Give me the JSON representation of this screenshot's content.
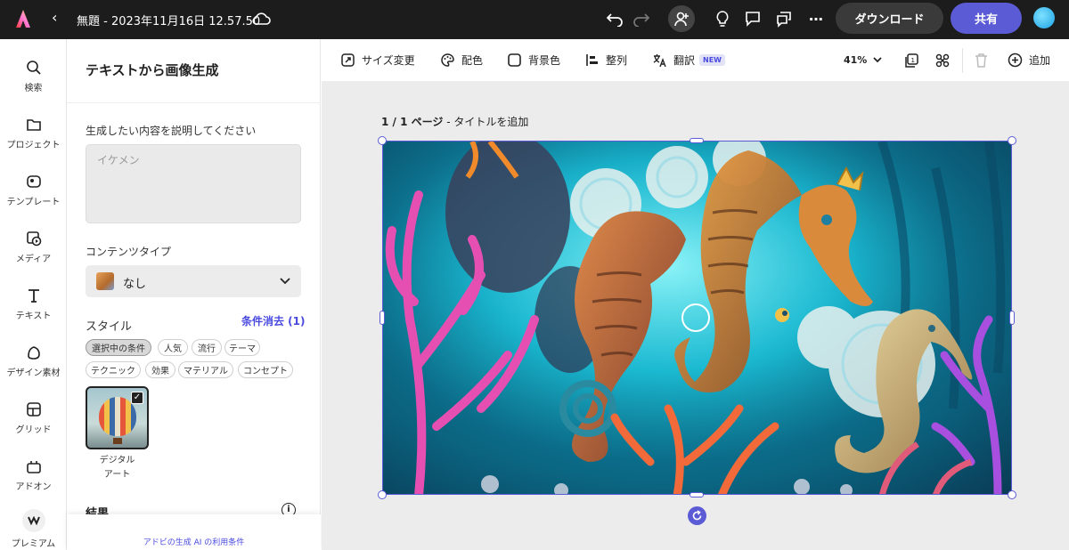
{
  "topbar": {
    "doc_title": "無題 - 2023年11月16日 12.57.50",
    "download_label": "ダウンロード",
    "share_label": "共有"
  },
  "rail": {
    "items": [
      {
        "label": "検索",
        "icon": "search-icon"
      },
      {
        "label": "プロジェクト",
        "icon": "folder-icon"
      },
      {
        "label": "テンプレート",
        "icon": "template-icon"
      },
      {
        "label": "メディア",
        "icon": "media-icon"
      },
      {
        "label": "テキスト",
        "icon": "text-icon"
      },
      {
        "label": "デザイン素材",
        "icon": "shapes-icon"
      },
      {
        "label": "グリッド",
        "icon": "grid-icon"
      },
      {
        "label": "アドオン",
        "icon": "addon-icon"
      },
      {
        "label": "プレミアム",
        "icon": "premium-icon"
      }
    ]
  },
  "panel": {
    "title": "テキストから画像生成",
    "prompt_label": "生成したい内容を説明してください",
    "prompt_placeholder": "イケメン",
    "content_type_label": "コンテンツタイプ",
    "content_type_value": "なし",
    "style_label": "スタイル",
    "clear_label": "条件消去 (1)",
    "chips": [
      "選択中の条件",
      "人気",
      "流行",
      "テーマ",
      "テクニック",
      "効果",
      "マテリアル",
      "コンセプト"
    ],
    "style_card_line1": "デジタル",
    "style_card_line2": "アート",
    "results_label": "結果",
    "footer_link": "アドビの生成 AI の利用条件"
  },
  "toolbar": {
    "resize": "サイズ変更",
    "color": "配色",
    "background": "背景色",
    "arrange": "整列",
    "translate": "翻訳",
    "new_badge": "NEW",
    "zoom": "41%",
    "add": "追加"
  },
  "canvas": {
    "page_counter": "1 / 1 ページ",
    "page_title_action": " - タイトルを追加"
  },
  "colors": {
    "accent": "#5b5bd6",
    "topbar_bg": "#1c1c1c",
    "canvas_bg": "#ececec"
  }
}
